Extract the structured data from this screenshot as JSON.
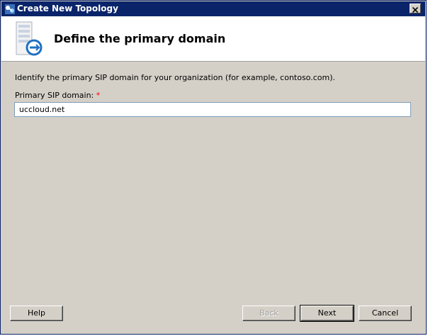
{
  "window": {
    "title": "Create New Topology",
    "close_glyph": "✕"
  },
  "header": {
    "title": "Define the primary domain",
    "icon": "server-sync-icon"
  },
  "body": {
    "description": "Identify the primary SIP domain for your organization (for example, contoso.com).",
    "field_label": "Primary SIP domain:",
    "required_marker": "*",
    "field_value": "uccloud.net"
  },
  "buttons": {
    "help": "Help",
    "back": "Back",
    "next": "Next",
    "cancel": "Cancel"
  },
  "colors": {
    "titlebar": "#0a246a",
    "dialog_bg": "#d4d0c8",
    "required": "#ff0000"
  }
}
